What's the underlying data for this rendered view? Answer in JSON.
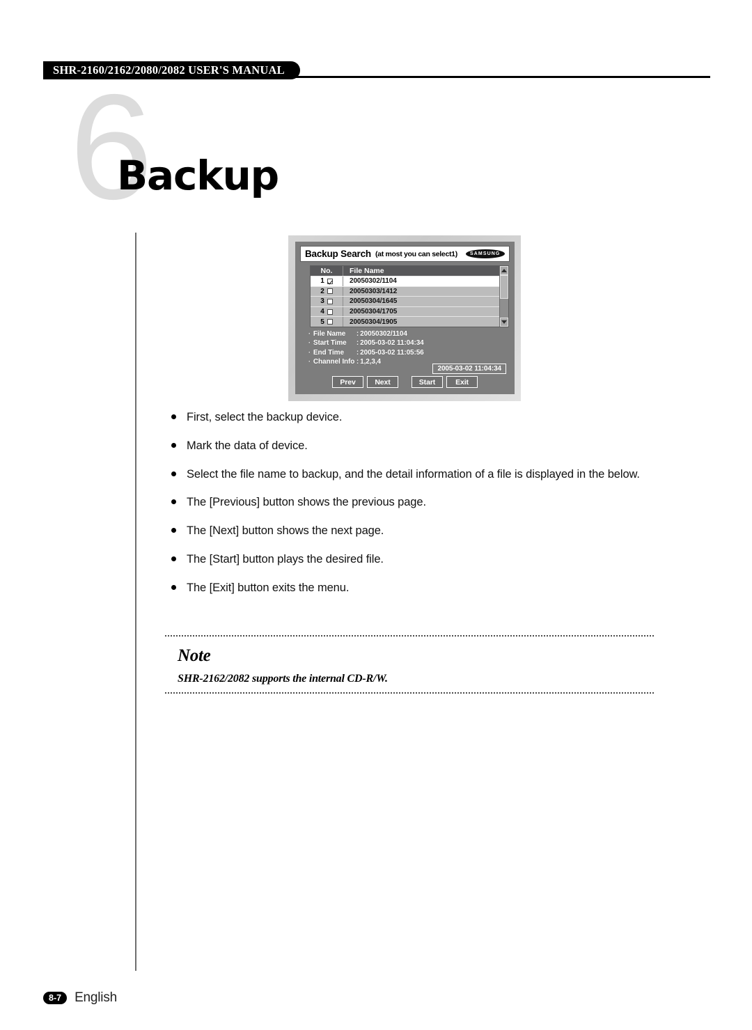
{
  "header": {
    "manual_title": "SHR-2160/2162/2080/2082 USER'S MANUAL"
  },
  "chapter": {
    "number": "6",
    "name": "Backup"
  },
  "dialog": {
    "title": "Backup Search",
    "title_note": "(at most you can select1)",
    "brand": "SAMSUNG",
    "table": {
      "columns": [
        "No.",
        "File Name"
      ],
      "rows": [
        {
          "no": "1",
          "checked": true,
          "file_name": "20050302/1104"
        },
        {
          "no": "2",
          "checked": false,
          "file_name": "20050303/1412"
        },
        {
          "no": "3",
          "checked": false,
          "file_name": "20050304/1645"
        },
        {
          "no": "4",
          "checked": false,
          "file_name": "20050304/1705"
        },
        {
          "no": "5",
          "checked": false,
          "file_name": "20050304/1905"
        }
      ]
    },
    "details": [
      {
        "label": "File Name",
        "sep": ":",
        "value": "20050302/1104"
      },
      {
        "label": "Start Time",
        "sep": ":",
        "value": "2005-03-02 11:04:34"
      },
      {
        "label": "End Time",
        "sep": ":",
        "value": "2005-03-02 11:05:56"
      },
      {
        "label": "Channel Info",
        "sep": ":",
        "value": "1,2,3,4"
      }
    ],
    "clock": "2005-03-02  11:04:34",
    "buttons": {
      "prev": "Prev",
      "next": "Next",
      "start": "Start",
      "exit": "Exit"
    }
  },
  "bullets": [
    "First, select the backup device.",
    "Mark the data of device.",
    "Select the file name to backup, and the detail information of a file is displayed in the below.",
    "The [Previous] button shows the previous page.",
    "The [Next] button shows the next page.",
    "The [Start] button plays the desired file.",
    "The [Exit] button exits the menu."
  ],
  "note": {
    "title": "Note",
    "text": "SHR-2162/2082 supports the internal CD-R/W."
  },
  "footer": {
    "page": "8-7",
    "language": "English"
  }
}
